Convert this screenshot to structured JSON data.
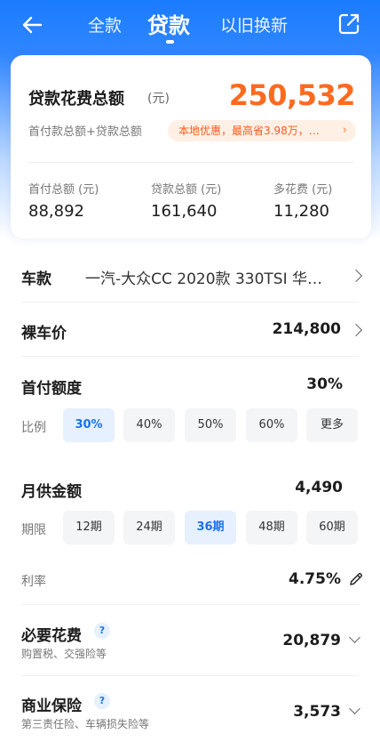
{
  "topbar": {
    "tabs": [
      {
        "label": "全款"
      },
      {
        "label": "贷款"
      },
      {
        "label": "以旧换新"
      }
    ]
  },
  "summary": {
    "title": "贷款花费总额",
    "title_unit": "(元)",
    "total": "250,532",
    "subtitle": "首付款总额+贷款总额",
    "promo": "本地优惠，最高省3.98万，…",
    "stats": [
      {
        "label": "首付总额 (元)",
        "value": "88,892"
      },
      {
        "label": "贷款总额 (元)",
        "value": "161,640"
      },
      {
        "label": "多花费 (元)",
        "value": "11,280"
      }
    ]
  },
  "car": {
    "label": "车款",
    "value": "一汽-大众CC 2020款 330TSI 华…"
  },
  "price": {
    "label": "裸车价",
    "value": "214,800"
  },
  "down_payment": {
    "label": "首付额度",
    "value": "30%",
    "option_label": "比例",
    "options": [
      "30%",
      "40%",
      "50%",
      "60%",
      "更多"
    ],
    "selected": "30%"
  },
  "monthly": {
    "label": "月供金额",
    "value": "4,490",
    "option_label": "期限",
    "options": [
      "12期",
      "24期",
      "36期",
      "48期",
      "60期"
    ],
    "selected": "36期"
  },
  "rate": {
    "label": "利率",
    "value": "4.75%"
  },
  "required": {
    "label": "必要花费",
    "note": "购置税、交强险等",
    "value": "20,879",
    "help": "?"
  },
  "insurance": {
    "label": "商业保险",
    "note": "第三责任险、车辆损失险等",
    "value": "3,573",
    "help": "?"
  },
  "colors": {
    "accent": "#1b7cff",
    "total": "#ff6a1f",
    "promo_bg": "#fff0e6",
    "selected_bg": "#e6f0ff",
    "selected_text": "#1a73e8"
  }
}
